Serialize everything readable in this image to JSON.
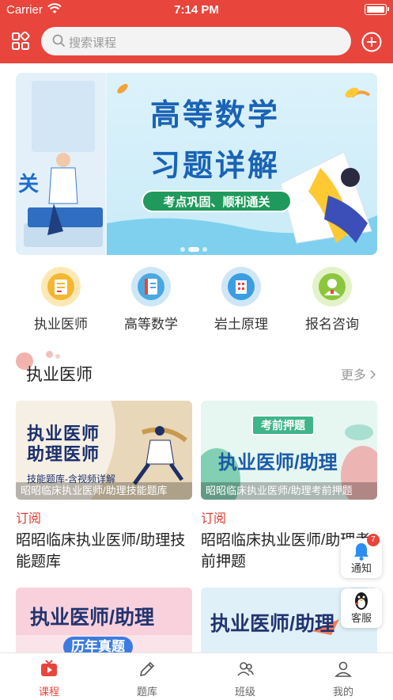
{
  "status": {
    "carrier": "Carrier",
    "time": "7:14 PM"
  },
  "header": {
    "search_placeholder": "搜索课程",
    "bg": "#e8453c"
  },
  "banner": {
    "left_fragment": "关",
    "title_line1": "高等数学",
    "title_line2": "习题详解",
    "slogan": "考点巩固、顺利通关"
  },
  "categories": [
    {
      "label": "执业医师",
      "icon": "doctor-certificate-icon",
      "color": "#f5b731"
    },
    {
      "label": "高等数学",
      "icon": "math-book-icon",
      "color": "#4aa8e0"
    },
    {
      "label": "岩土原理",
      "icon": "building-icon",
      "color": "#3b9ee0"
    },
    {
      "label": "报名咨询",
      "icon": "consultant-icon",
      "color": "#8cc63f"
    }
  ],
  "section": {
    "title": "执业医师",
    "more": "更多"
  },
  "courses": [
    {
      "thumb_line1": "执业医师",
      "thumb_line2": "助理医师",
      "thumb_tag": "技能题库-含视频详解",
      "caption": "昭昭临床执业医师/助理技能题库",
      "tag": "订阅",
      "name": "昭昭临床执业医师/助理技能题库"
    },
    {
      "thumb_badge": "考前押题",
      "thumb_line1": "执业医师/助理",
      "caption": "昭昭临床执业医师/助理考前押题",
      "tag": "订阅",
      "name": "昭昭临床执业医师/助理考前押题"
    },
    {
      "thumb_line1": "执业医师/助理",
      "thumb_line2": "历年真题"
    },
    {
      "thumb_line1": "执业医师/助理"
    }
  ],
  "floating": {
    "notify_label": "通知",
    "notify_badge": "7",
    "service_label": "客服"
  },
  "tabs": [
    {
      "label": "课程",
      "icon": "tv-icon",
      "active": true
    },
    {
      "label": "题库",
      "icon": "pencil-icon",
      "active": false
    },
    {
      "label": "班级",
      "icon": "class-group-icon",
      "active": false
    },
    {
      "label": "我的",
      "icon": "user-icon",
      "active": false
    }
  ]
}
